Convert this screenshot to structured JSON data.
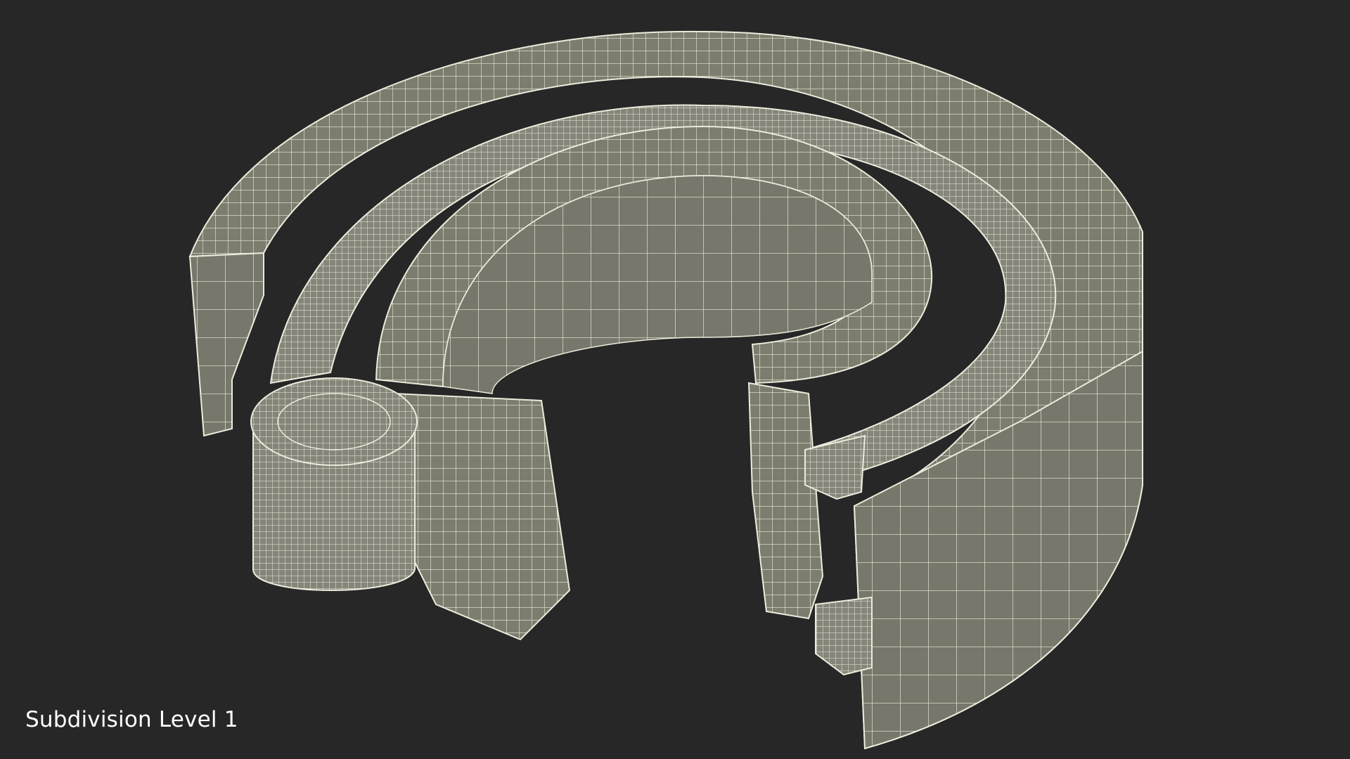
{
  "caption": {
    "text": "Subdivision Level 1"
  },
  "scene": {
    "object": "bearing-wireframe",
    "background_color": "#272727",
    "surface_color": "#7d7d6f",
    "wire_color": "#ecebdc"
  }
}
